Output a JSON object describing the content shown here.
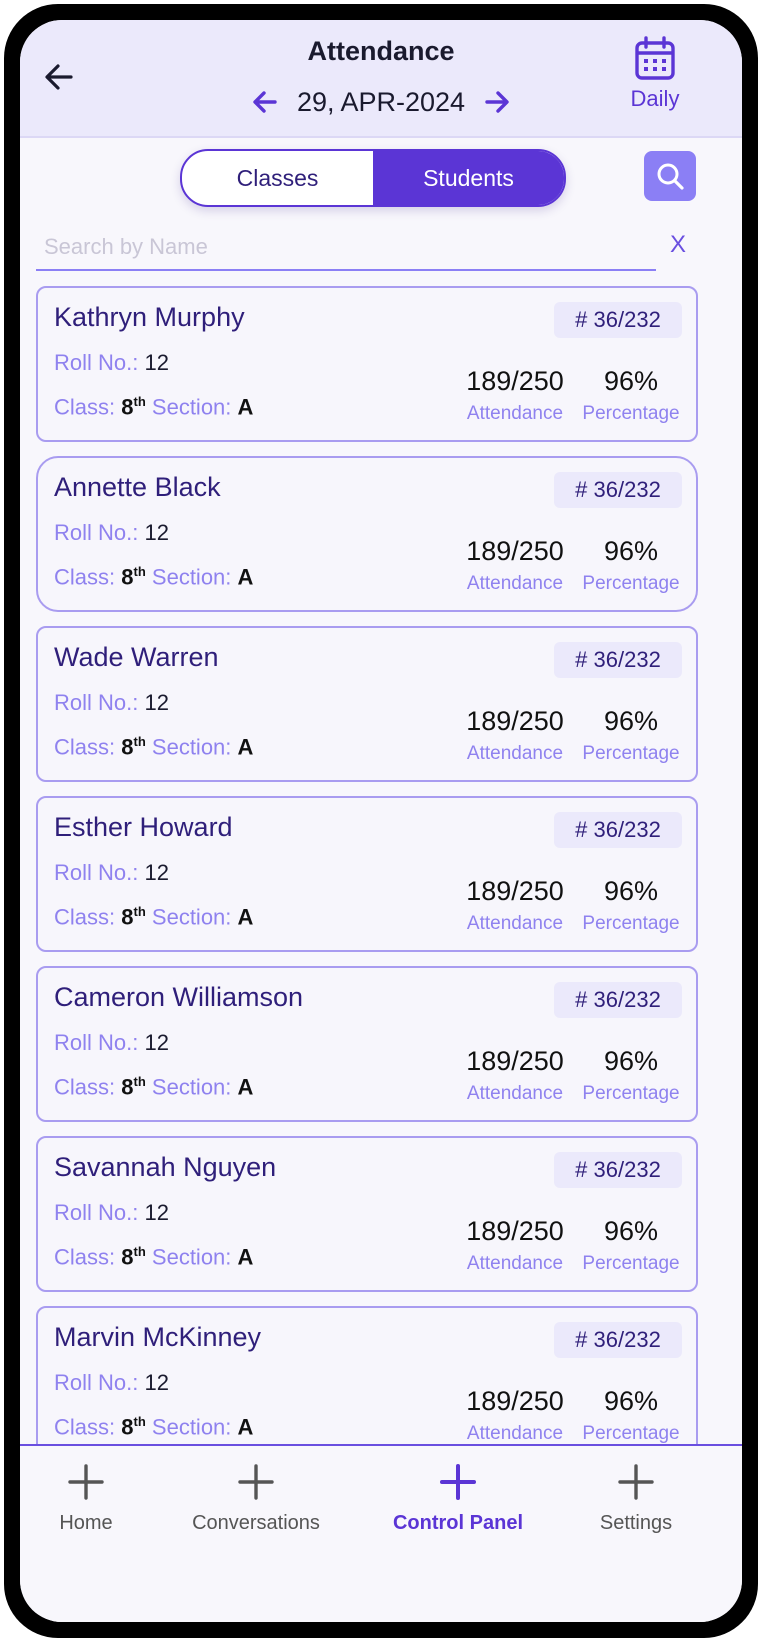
{
  "header": {
    "title": "Attendance",
    "date": "29, APR-2024",
    "view_mode": "Daily"
  },
  "tabs": [
    {
      "label": "Classes",
      "active": false
    },
    {
      "label": "Students",
      "active": true
    }
  ],
  "search": {
    "placeholder": "Search by Name",
    "value": "",
    "clear_label": "X"
  },
  "labels": {
    "roll_no": "Roll No.:",
    "class": "Class:",
    "section": "Section:",
    "attendance": "Attendance",
    "percentage": "Percentage"
  },
  "students": [
    {
      "name": "Kathryn Murphy",
      "rank": "# 36/232",
      "roll_no": "12",
      "class": "8",
      "class_suffix": "th",
      "section": "A",
      "attendance": "189/250",
      "percentage": "96%"
    },
    {
      "name": "Annette Black",
      "rank": "# 36/232",
      "roll_no": "12",
      "class": "8",
      "class_suffix": "th",
      "section": "A",
      "attendance": "189/250",
      "percentage": "96%"
    },
    {
      "name": "Wade Warren",
      "rank": "# 36/232",
      "roll_no": "12",
      "class": "8",
      "class_suffix": "th",
      "section": "A",
      "attendance": "189/250",
      "percentage": "96%"
    },
    {
      "name": "Esther Howard",
      "rank": "# 36/232",
      "roll_no": "12",
      "class": "8",
      "class_suffix": "th",
      "section": "A",
      "attendance": "189/250",
      "percentage": "96%"
    },
    {
      "name": "Cameron Williamson",
      "rank": "# 36/232",
      "roll_no": "12",
      "class": "8",
      "class_suffix": "th",
      "section": "A",
      "attendance": "189/250",
      "percentage": "96%"
    },
    {
      "name": "Savannah Nguyen",
      "rank": "# 36/232",
      "roll_no": "12",
      "class": "8",
      "class_suffix": "th",
      "section": "A",
      "attendance": "189/250",
      "percentage": "96%"
    },
    {
      "name": "Marvin McKinney",
      "rank": "# 36/232",
      "roll_no": "12",
      "class": "8",
      "class_suffix": "th",
      "section": "A",
      "attendance": "189/250",
      "percentage": "96%"
    }
  ],
  "bottom_nav": [
    {
      "label": "Home",
      "icon": "plus-icon",
      "active": false
    },
    {
      "label": "Conversations",
      "icon": "plus-icon",
      "active": false
    },
    {
      "label": "Control Panel",
      "icon": "plus-icon",
      "active": true
    },
    {
      "label": "Settings",
      "icon": "plus-icon",
      "active": false
    }
  ],
  "colors": {
    "accent": "#5b35d5",
    "accent_light": "#8b7ff5",
    "header_bg": "#ebe9fb",
    "text_dark": "#2f1f7a"
  }
}
